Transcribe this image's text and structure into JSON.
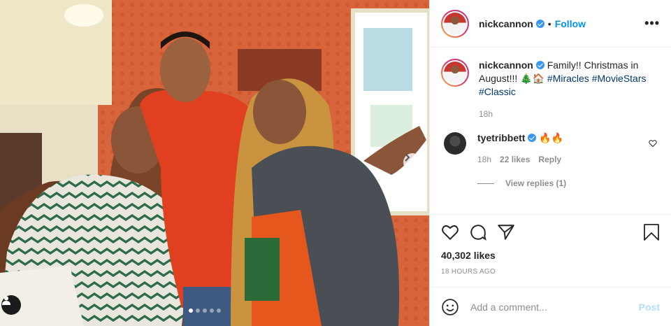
{
  "post": {
    "username": "nickcannon",
    "follow_label": "Follow",
    "separator": "•",
    "more_label": "•••",
    "caption_text": "Family!! Christmas in August!!! 🎄🏠",
    "hashtags": [
      "#Miracles",
      "#MovieStars",
      "#Classic"
    ],
    "caption_time": "18h",
    "comment": {
      "username": "tyetribbett",
      "text": "🔥🔥",
      "time": "18h",
      "likes": "22 likes",
      "reply_label": "Reply"
    },
    "view_replies": "View replies (1)",
    "likes": "40,302 likes",
    "time_ago": "18 HOURS AGO",
    "comment_placeholder": "Add a comment...",
    "post_label": "Post",
    "carousel_slides": 5,
    "carousel_active": 0,
    "colors": {
      "accent": "#0095f6",
      "verified": "#3897f0",
      "wall": "#d8673a",
      "sweater": "#e0401f"
    },
    "icons": [
      "user-tag-icon",
      "chevron-right-icon",
      "heart-icon",
      "comment-icon",
      "share-icon",
      "bookmark-icon",
      "emoji-icon",
      "more-icon",
      "verified-icon"
    ]
  }
}
